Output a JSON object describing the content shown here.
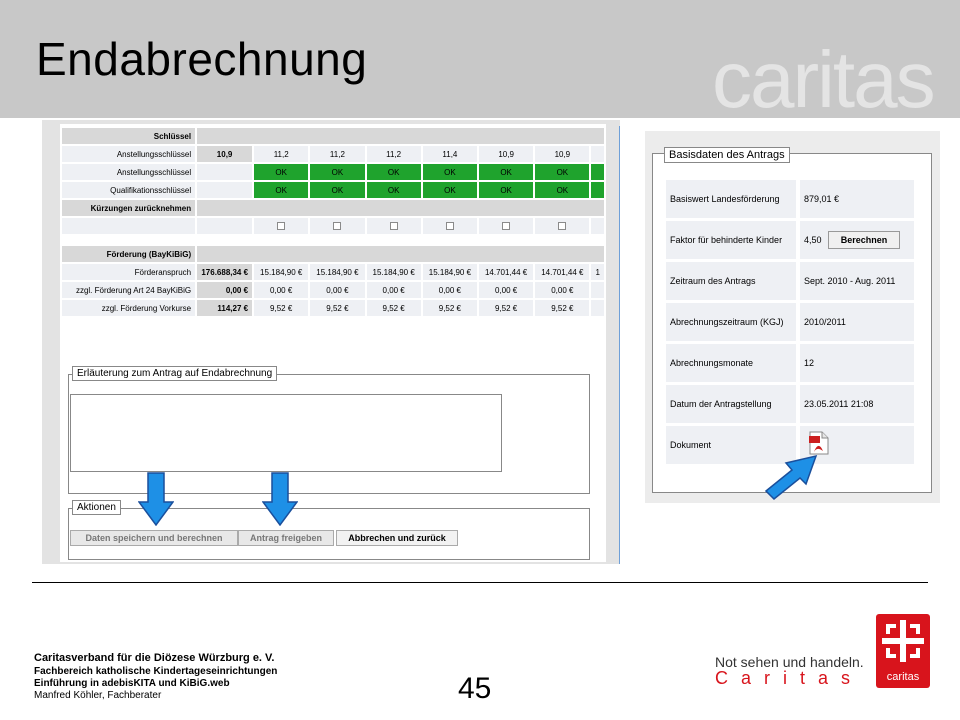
{
  "slide": {
    "title": "Endabrechnung",
    "wordmark": "caritas"
  },
  "table": {
    "section_schluessel": "Schlüssel",
    "row_anstellung": {
      "label": "Anstellungsschlüssel",
      "values": [
        "10,9",
        "11,2",
        "11,2",
        "11,2",
        "11,4",
        "10,9",
        "10,9"
      ]
    },
    "row_anstellung_ok": {
      "label": "Anstellungsschlüssel",
      "values": [
        "OK",
        "OK",
        "OK",
        "OK",
        "OK",
        "OK"
      ]
    },
    "row_qualifikation_ok": {
      "label": "Qualifikationsschlüssel",
      "values": [
        "OK",
        "OK",
        "OK",
        "OK",
        "OK",
        "OK"
      ]
    },
    "section_kuerzungen": "Kürzungen zurücknehmen",
    "section_foerderung": "Förderung (BayKiBiG)",
    "row_foerderanspruch": {
      "label": "Förderanspruch",
      "values": [
        "176.688,34 €",
        "15.184,90 €",
        "15.184,90 €",
        "15.184,90 €",
        "15.184,90 €",
        "14.701,44 €",
        "14.701,44 €"
      ],
      "trailing": "1"
    },
    "row_art24": {
      "label": "zzgl. Förderung Art 24 BayKiBiG",
      "values": [
        "0,00 €",
        "0,00 €",
        "0,00 €",
        "0,00 €",
        "0,00 €",
        "0,00 €",
        "0,00 €"
      ]
    },
    "row_vorkurse": {
      "label": "zzgl. Förderung Vorkurse",
      "values": [
        "114,27 €",
        "9,52 €",
        "9,52 €",
        "9,52 €",
        "9,52 €",
        "9,52 €",
        "9,52 €"
      ]
    }
  },
  "explain": {
    "legend": "Erläuterung zum Antrag auf Endabrechnung",
    "text": ""
  },
  "actions": {
    "legend": "Aktionen",
    "save": "Daten speichern und berechnen",
    "release": "Antrag freigeben",
    "cancel": "Abbrechen und zurück"
  },
  "basis": {
    "legend": "Basisdaten des Antrags",
    "rows": [
      {
        "label": "Basiswert Landesförderung",
        "value": "879,01 €"
      },
      {
        "label": "Faktor für behinderte Kinder",
        "value": "4,50"
      },
      {
        "label": "Zeitraum des Antrags",
        "value": "Sept. 2010 - Aug. 2011"
      },
      {
        "label": "Abrechnungszeitraum (KGJ)",
        "value": "2010/2011"
      },
      {
        "label": "Abrechnungsmonate",
        "value": "12"
      },
      {
        "label": "Datum der Antragstellung",
        "value": "23.05.2011 21:08"
      },
      {
        "label": "Dokument",
        "value": ""
      }
    ],
    "calc_button": "Berechnen"
  },
  "footer": {
    "org": "Caritasverband für die Diözese Würzburg e. V.",
    "dept": "Fachbereich katholische Kindertageseinrichtungen",
    "course": "Einführung in adebisKITA und KiBiG.web",
    "author": "Manfred Köhler, Fachberater",
    "page": "45",
    "slogan_line1": "Not sehen und handeln.",
    "slogan_line2": "Caritas",
    "logo_text": "caritas"
  },
  "colors": {
    "header_bg": "#c8c8c8",
    "ok_green": "#1fa32d",
    "arrow_blue": "#1e90e6",
    "caritas_red": "#d8141c"
  }
}
